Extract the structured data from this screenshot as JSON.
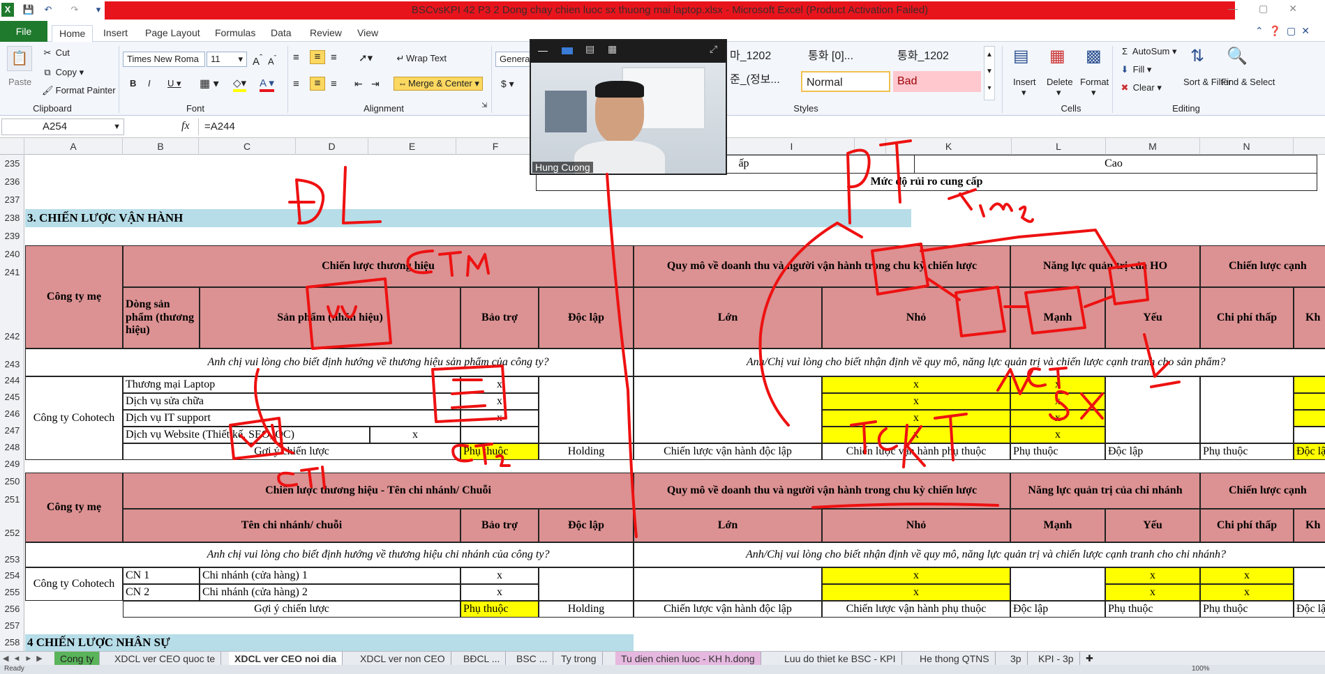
{
  "window": {
    "title": "BSCvsKPI 42 P3 2 Dong chay chien luoc sx thuong mai laptop.xlsx  -  Microsoft Excel (Product Activation Failed)"
  },
  "ribbon": {
    "file_tab": "File",
    "tabs": [
      "Home",
      "Insert",
      "Page Layout",
      "Formulas",
      "Data",
      "Review",
      "View"
    ],
    "clipboard": {
      "paste": "Paste",
      "cut": "Cut",
      "copy": "Copy",
      "format_painter": "Format Painter",
      "label": "Clipboard"
    },
    "font": {
      "name": "Times New Roma",
      "size": "11",
      "label": "Font"
    },
    "alignment": {
      "wrap_text": "Wrap Text",
      "merge_center": "Merge & Center",
      "label": "Alignment"
    },
    "number": {
      "format": "General",
      "currency": "$"
    },
    "styles": {
      "label": "Styles",
      "row1": [
        "마_1202",
        "통화 [0]...",
        "통화_1202"
      ],
      "row2": [
        "준_(정보...",
        "Normal",
        "Bad"
      ]
    },
    "cells": {
      "insert": "Insert",
      "delete": "Delete",
      "format": "Format",
      "label": "Cells"
    },
    "editing": {
      "autosum": "AutoSum",
      "fill": "Fill",
      "clear": "Clear",
      "sort_filter": "Sort & Filter",
      "find_select": "Find & Select",
      "label": "Editing"
    }
  },
  "formula_bar": {
    "name_box": "A254",
    "fx": "fx",
    "formula": "=A244"
  },
  "columns": [
    "A",
    "B",
    "C",
    "D",
    "E",
    "F",
    "I",
    "K",
    "L",
    "M",
    "N"
  ],
  "rows": [
    "235",
    "236",
    "237",
    "238",
    "239",
    "240",
    "241",
    "242",
    "243",
    "244",
    "245",
    "246",
    "247",
    "248",
    "249",
    "250",
    "251",
    "252",
    "253",
    "254",
    "255",
    "256",
    "257",
    "258"
  ],
  "sheet": {
    "r235_cap": "ấp",
    "r235_cao": "Cao",
    "r236": "Mức độ rủi ro cung cấp",
    "sec3": "3. CHIẾN LƯỢC VẬN HÀNH",
    "sec4": "4 CHIẾN LƯỢC NHÂN SỰ",
    "t1": {
      "parent": "Công ty mẹ",
      "brand_strategy": "Chiến lược thương hiệu",
      "scale": "Quy mô về doanh thu và người vận hành trong chu kỳ chiến lược",
      "capability": "Năng lực quản trị của HO",
      "competitive": "Chiến lược cạnh",
      "product_line": "Dòng sản phẩm (thương hiệu)",
      "product": "Sản phẩm (nhãn hiệu)",
      "sponsored": "Bảo trợ",
      "independent": "Độc lập",
      "large": "Lớn",
      "small": "Nhỏ",
      "strong": "Mạnh",
      "weak": "Yếu",
      "low_cost": "Chi phí thấp",
      "k_trunc": "Kh",
      "q1": "Anh chị vui lòng cho biết định hướng về thương hiệu sản phẩm của công ty?",
      "q2": "Anh/Chị vui lòng cho biết nhận định về quy mô, năng lực quản trị và chiến lược cạnh tranh cho sản phẩm?",
      "company": "Công ty Cohotech",
      "items": [
        "Thương mại Laptop",
        "Dịch vụ sửa chữa",
        "Dịch vụ IT support",
        "Dịch vụ Website (Thiết kế, SEO, QC)"
      ],
      "mark": "x",
      "suggest": "Gợi ý chiến lược",
      "dependent": "Phụ thuộc",
      "holding": "Holding",
      "op_independent": "Chiến lược vận hành độc lập",
      "op_dependent": "Chiến lược vận hành phụ thuộc",
      "dep": "Phụ thuộc",
      "indep": "Độc lập",
      "dep2": "Phụ thuộc",
      "indep_trunc": "Độc lậ"
    },
    "t2": {
      "parent": "Công ty mẹ",
      "brand_strategy": "Chiến lược thương hiệu - Tên chi nhánh/ Chuỗi",
      "scale": "Quy mô về doanh thu và người vận hành trong chu kỳ chiến lược",
      "capability": "Năng lực quản trị của chi nhánh",
      "competitive": "Chiến lược cạnh",
      "branch_name": "Tên chi nhánh/ chuỗi",
      "sponsored": "Bảo trợ",
      "independent": "Độc lập",
      "large": "Lớn",
      "small": "Nhỏ",
      "strong": "Mạnh",
      "weak": "Yếu",
      "low_cost": "Chi phí thấp",
      "k_trunc": "Kh",
      "q1": "Anh chị vui lòng cho biết định hướng về thương hiệu chi nhánh của công ty?",
      "q2": "Anh/Chị vui lòng cho biết nhận định về quy mô, năng lực quản trị và chiến lược cạnh tranh cho chi nhánh?",
      "company": "Công ty Cohotech",
      "cn1": "CN 1",
      "cn2": "CN 2",
      "branch1": "Chi nhánh (cửa hàng) 1",
      "branch2": "Chi nhánh (cửa hàng) 2",
      "mark": "x",
      "suggest": "Gợi ý chiến lược",
      "dependent": "Phụ thuộc",
      "holding": "Holding",
      "op_independent": "Chiến lược vận hành độc lập",
      "op_dependent": "Chiến lược vận hành phụ thuộc",
      "indep": "Độc lập",
      "dep": "Phụ thuộc",
      "dep2": "Phụ thuộc",
      "indep_trunc": "Độc lậ"
    }
  },
  "sheet_tabs": [
    "Cong ty",
    "XDCL ver CEO quoc te",
    "XDCL ver CEO noi dia",
    "XDCL ver non CEO",
    "BĐCL ...",
    "BSC ...",
    "Ty trong",
    "Tu dien chien luoc - KH h.dong",
    "Luu do thiet ke BSC - KPI",
    "He thong QTNS",
    "3p",
    "KPI - 3p"
  ],
  "status": {
    "ready": "Ready",
    "zoom": "100%"
  },
  "video": {
    "name": "Hung Cuong"
  },
  "annotations": {
    "color": "#ee1111",
    "labels": [
      "ĐL",
      "PT",
      "CTM",
      "Time",
      "CT1",
      "CT2",
      "KT",
      "SX",
      "CT",
      "TC"
    ]
  }
}
